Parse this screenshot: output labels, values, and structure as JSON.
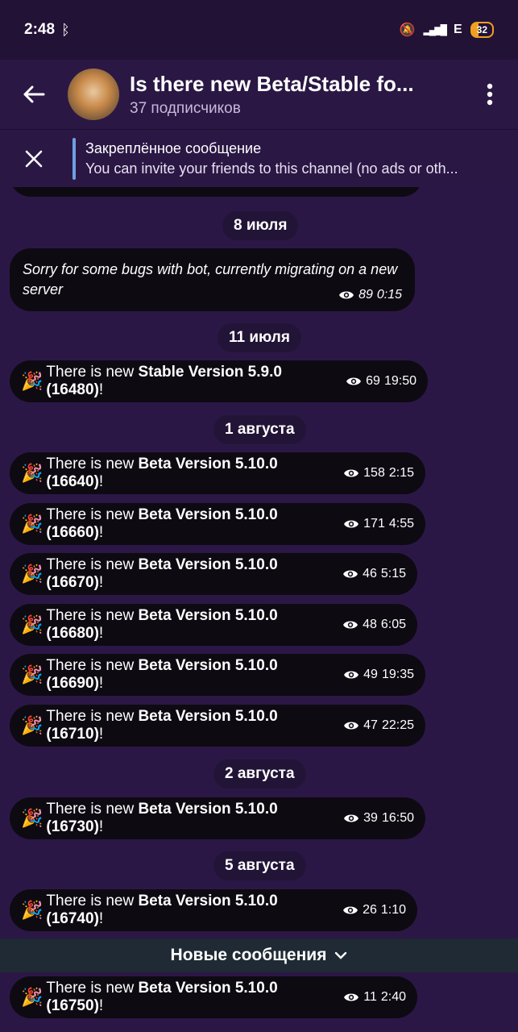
{
  "status_bar": {
    "time": "2:48",
    "network": "E",
    "battery": "32"
  },
  "header": {
    "title": "Is there new Beta/Stable fo...",
    "subscribers": "37 подписчиков"
  },
  "pinned": {
    "title": "Закреплённое сообщение",
    "text": "You can invite your friends to this channel (no ads or oth..."
  },
  "dates": [
    "8 июля",
    "11 июля",
    "1 августа",
    "2 августа",
    "5 августа"
  ],
  "new_messages_label": "Новые сообщения",
  "messages": [
    {
      "text": "Sorry for some bugs with bot, currently migrating on a new server",
      "views": "89",
      "time": "0:15"
    },
    {
      "prefix": "There is new ",
      "bold": "Stable Version 5.9.0 (16480)",
      "suffix": "!",
      "views": "69",
      "time": "19:50"
    },
    {
      "prefix": "There is new ",
      "bold": "Beta Version 5.10.0 (16640)",
      "suffix": "!",
      "views": "158",
      "time": "2:15"
    },
    {
      "prefix": "There is new ",
      "bold": "Beta Version 5.10.0 (16660)",
      "suffix": "!",
      "views": "171",
      "time": "4:55"
    },
    {
      "prefix": "There is new ",
      "bold": "Beta Version 5.10.0 (16670)",
      "suffix": "!",
      "views": "46",
      "time": "5:15"
    },
    {
      "prefix": "There is new ",
      "bold": "Beta Version 5.10.0 (16680)",
      "suffix": "!",
      "views": "48",
      "time": "6:05"
    },
    {
      "prefix": "There is new ",
      "bold": "Beta Version 5.10.0 (16690)",
      "suffix": "!",
      "views": "49",
      "time": "19:35"
    },
    {
      "prefix": "There is new ",
      "bold": "Beta Version 5.10.0 (16710)",
      "suffix": "!",
      "views": "47",
      "time": "22:25"
    },
    {
      "prefix": "There is new ",
      "bold": "Beta Version 5.10.0 (16730)",
      "suffix": "!",
      "views": "39",
      "time": "16:50"
    },
    {
      "prefix": "There is new ",
      "bold": "Beta Version 5.10.0 (16740)",
      "suffix": "!",
      "views": "26",
      "time": "1:10"
    },
    {
      "prefix": "There is new ",
      "bold": "Beta Version 5.10.0 (16750)",
      "suffix": "!",
      "views": "11",
      "time": "2:40"
    }
  ],
  "icons": {
    "emoji": "party-popper",
    "views": "eye-icon"
  }
}
